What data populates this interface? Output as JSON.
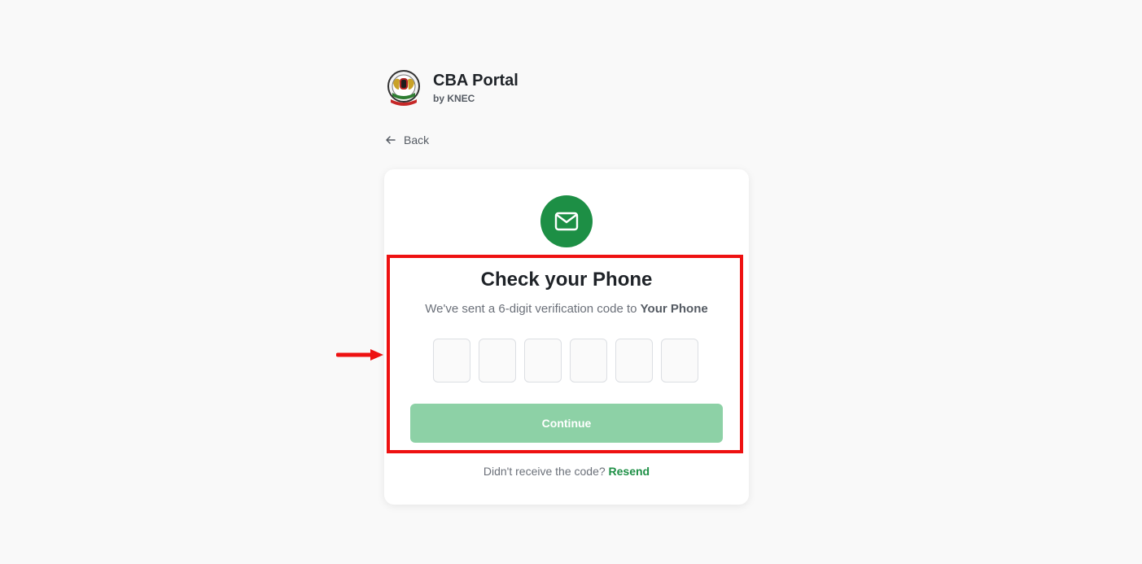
{
  "brand": {
    "title": "CBA Portal",
    "subtitle": "by KNEC"
  },
  "nav": {
    "back_label": "Back"
  },
  "verification": {
    "heading": "Check your Phone",
    "subtext_prefix": "We've sent a 6-digit verification code to ",
    "subtext_target": "Your Phone",
    "otp_digits": [
      "",
      "",
      "",
      "",
      "",
      ""
    ],
    "continue_label": "Continue",
    "resend_prompt": "Didn't receive the code? ",
    "resend_label": "Resend"
  },
  "icons": {
    "logo": "kenya-coat-of-arms-logo",
    "back": "arrow-left-icon",
    "mail": "mail-icon",
    "annotation_arrow": "red-arrow-right-icon"
  },
  "colors": {
    "accent": "#1d8f45",
    "button_disabled": "#8dd1a6",
    "highlight_border": "#ee1111",
    "background": "#f9f9f9"
  }
}
